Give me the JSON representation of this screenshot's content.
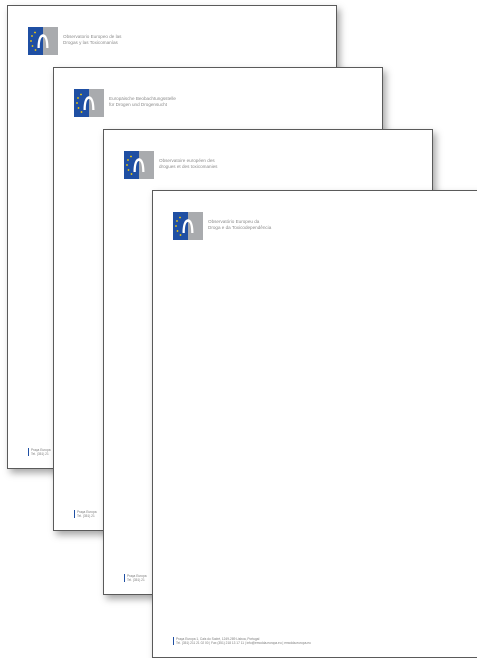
{
  "sheets": [
    {
      "org_line1": "Observatorio Europeo de las",
      "org_line2": "Drogas y las Toxicomanías",
      "footer_line1": "Praça Europa",
      "footer_line2": "Tel. (351) 21"
    },
    {
      "org_line1": "Europäische Beobachtungsstelle",
      "org_line2": "für Drogen und Drogensucht",
      "footer_line1": "Praça Europa",
      "footer_line2": "Tel. (351) 21"
    },
    {
      "org_line1": "Observatoire européen des",
      "org_line2": "drogues et des toxicomanies",
      "footer_line1": "Praça Europa",
      "footer_line2": "Tel. (351) 21"
    },
    {
      "org_line1": "Observatório Europeu da",
      "org_line2": "Droga e da Toxicodependência",
      "footer_line1": "Praça Europa 1, Cais do Sodré, 1249-289 Lisboa, Portugal",
      "footer_line2": "Tel. (351) 211 21 02 00 | Fax (351) 218 13 17 11 | info@emcdda.europa.eu | emcdda.europa.eu"
    }
  ],
  "colors": {
    "logo_blue": "#1f4fa3",
    "logo_grey": "#a9abae",
    "text_grey": "#8c8c8c"
  },
  "icons": {
    "logo": "emcdda-logo-icon"
  }
}
